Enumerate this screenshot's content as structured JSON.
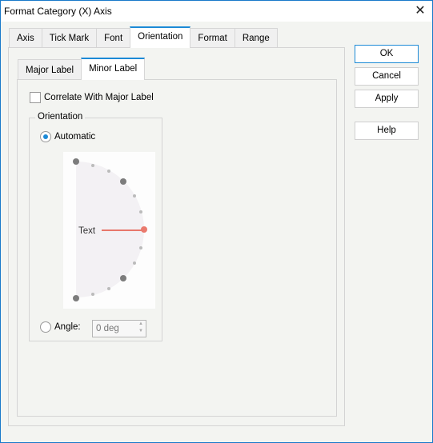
{
  "window": {
    "title": "Format Category (X) Axis",
    "close_icon": "close-icon"
  },
  "tabs": [
    {
      "label": "Axis",
      "active": false
    },
    {
      "label": "Tick Mark",
      "active": false
    },
    {
      "label": "Font",
      "active": false
    },
    {
      "label": "Orientation",
      "active": true
    },
    {
      "label": "Format",
      "active": false
    },
    {
      "label": "Range",
      "active": false
    }
  ],
  "subtabs": [
    {
      "label": "Major Label",
      "active": false
    },
    {
      "label": "Minor Label",
      "active": true
    }
  ],
  "correlate": {
    "label": "Correlate With Major Label",
    "checked": false
  },
  "orientation_group": {
    "label": "Orientation",
    "automatic": {
      "label": "Automatic",
      "checked": true
    },
    "dial": {
      "text_label": "Text",
      "angle_deg": 0
    },
    "angle": {
      "label": "Angle:",
      "checked": false,
      "value": "0 deg"
    }
  },
  "buttons": {
    "ok": "OK",
    "cancel": "Cancel",
    "apply": "Apply",
    "help": "Help"
  }
}
